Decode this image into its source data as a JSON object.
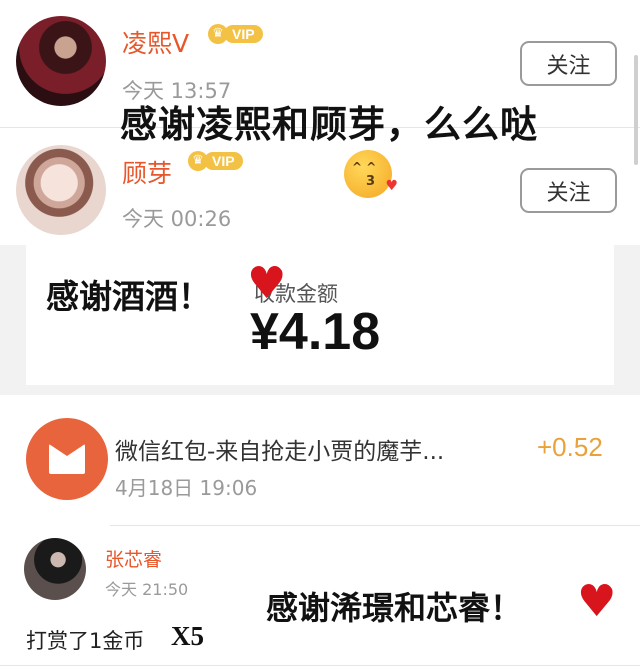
{
  "card1": {
    "username": "凌熙V",
    "vip": "VIP",
    "time": "今天 13:57",
    "follow": "关注"
  },
  "card2": {
    "username": "顾芽",
    "vip": "VIP",
    "time": "今天 00:26",
    "follow": "关注"
  },
  "overlay1": "感谢凌熙和顾芽，么么哒",
  "overlay2": "感谢酒酒！",
  "overlay3": "感谢浠璟和芯睿！",
  "overlay4": "X5",
  "payment": {
    "label": "收款金额",
    "amount": "¥4.18"
  },
  "transaction": {
    "title": "微信红包-来自抢走小贾的魔芋...",
    "time": "4月18日 19:06",
    "amount": "+0.52"
  },
  "reward": {
    "username": "张芯睿",
    "time": "今天 21:50",
    "text": "打赏了1金币"
  },
  "icons": {
    "emoji": "kissing-face-emoji",
    "heart": "red-heart",
    "crown": "crown-icon",
    "envelope": "red-envelope-icon"
  },
  "colors": {
    "username": "#e8562a",
    "vip": "#f3c143",
    "amount": "#e9a23b",
    "redpacket": "#e8643c",
    "heart": "#d8141c"
  }
}
